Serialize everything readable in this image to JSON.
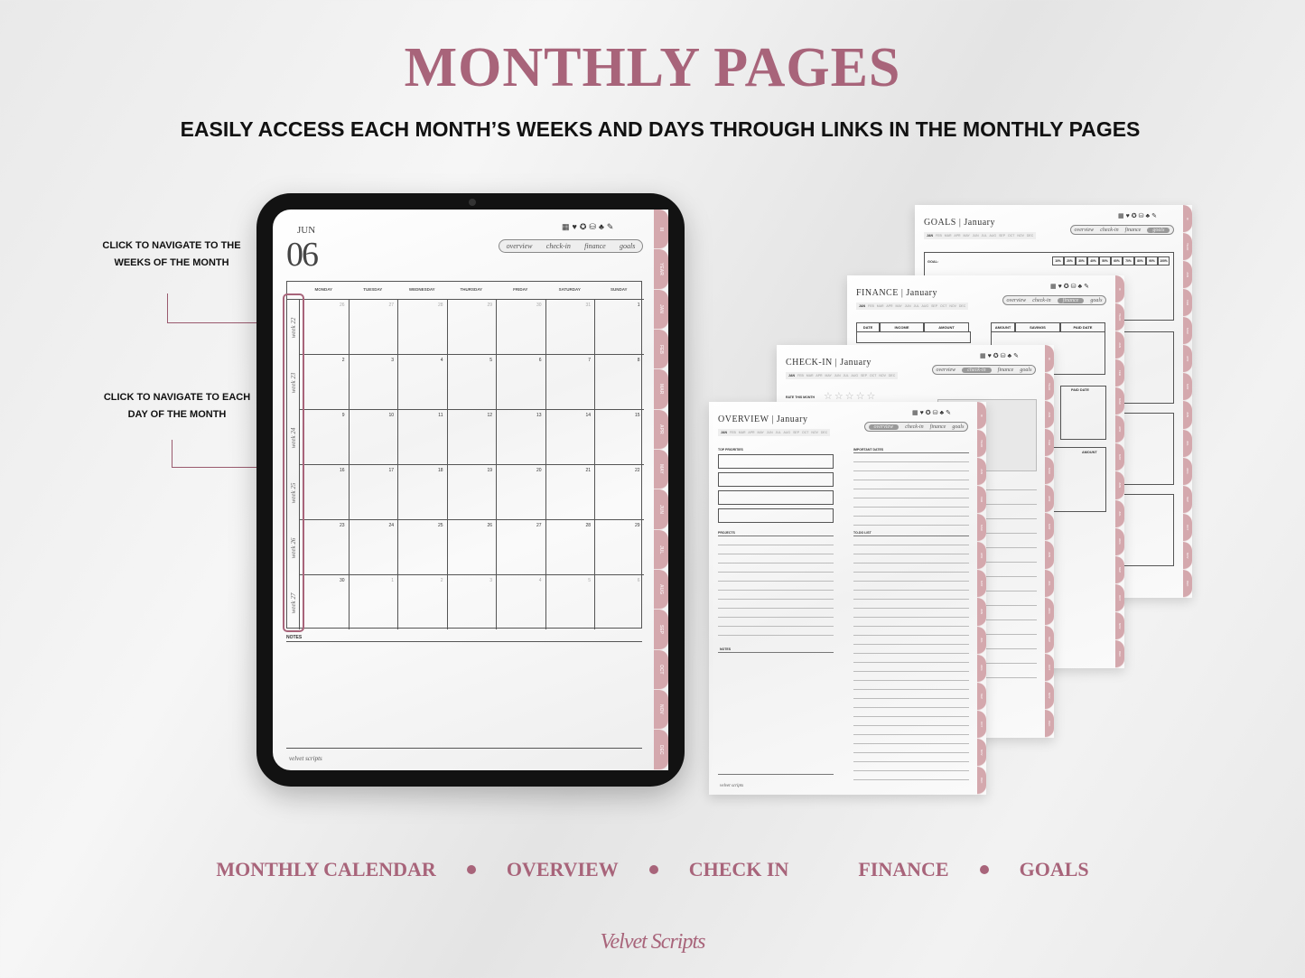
{
  "header": {
    "title": "MONTHLY PAGES",
    "subtitle": "EASILY ACCESS EACH MONTH’S WEEKS AND DAYS THROUGH LINKS IN THE MONTHLY PAGES"
  },
  "callouts": [
    {
      "line1": "CLICK TO NAVIGATE TO THE",
      "line2": "WEEKS OF THE MONTH"
    },
    {
      "line1": "CLICK TO NAVIGATE TO EACH",
      "line2": "DAY OF THE MONTH"
    }
  ],
  "colors": {
    "accent": "#a8647a",
    "tab": "#d4a8ad",
    "tablet": "#121212"
  },
  "header_icons": [
    "calendar-icon",
    "heart-icon",
    "check-badge-icon",
    "coins-icon",
    "plant-icon",
    "notes-icon"
  ],
  "nav_pill": [
    "overview",
    "check-in",
    "finance",
    "goals"
  ],
  "side_tabs": [
    "III",
    "YEAR",
    "JAN",
    "FEB",
    "MAR",
    "APR",
    "MAY",
    "JUN",
    "JUL",
    "AUG",
    "SEP",
    "OCT",
    "NOV",
    "DEC"
  ],
  "month_strip": [
    "JAN",
    "FEB",
    "MAR",
    "APR",
    "MAY",
    "JUN",
    "JUL",
    "AUG",
    "SEP",
    "OCT",
    "NOV",
    "DEC"
  ],
  "calendar": {
    "month": "JUN",
    "month_number": "06",
    "weekdays": [
      "MONDAY",
      "TUESDAY",
      "WEDNESDAY",
      "THURSDAY",
      "FRIDAY",
      "SATURDAY",
      "SUNDAY"
    ],
    "weeks": [
      {
        "label": "week 22",
        "days": [
          [
            "26",
            false
          ],
          [
            "27",
            false
          ],
          [
            "28",
            false
          ],
          [
            "29",
            false
          ],
          [
            "30",
            false
          ],
          [
            "31",
            false
          ],
          [
            "1",
            true
          ]
        ]
      },
      {
        "label": "week 23",
        "days": [
          [
            "2",
            true
          ],
          [
            "3",
            true
          ],
          [
            "4",
            true
          ],
          [
            "5",
            true
          ],
          [
            "6",
            true
          ],
          [
            "7",
            true
          ],
          [
            "8",
            true
          ]
        ]
      },
      {
        "label": "week 24",
        "days": [
          [
            "9",
            true
          ],
          [
            "10",
            true
          ],
          [
            "11",
            true
          ],
          [
            "12",
            true
          ],
          [
            "13",
            true
          ],
          [
            "14",
            true
          ],
          [
            "15",
            true
          ]
        ]
      },
      {
        "label": "week 25",
        "days": [
          [
            "16",
            true
          ],
          [
            "17",
            true
          ],
          [
            "18",
            true
          ],
          [
            "19",
            true
          ],
          [
            "20",
            true
          ],
          [
            "21",
            true
          ],
          [
            "22",
            true
          ]
        ]
      },
      {
        "label": "week 26",
        "days": [
          [
            "23",
            true
          ],
          [
            "24",
            true
          ],
          [
            "25",
            true
          ],
          [
            "26",
            true
          ],
          [
            "27",
            true
          ],
          [
            "28",
            true
          ],
          [
            "29",
            true
          ]
        ]
      },
      {
        "label": "week 27",
        "days": [
          [
            "30",
            true
          ],
          [
            "1",
            false
          ],
          [
            "2",
            false
          ],
          [
            "3",
            false
          ],
          [
            "4",
            false
          ],
          [
            "5",
            false
          ],
          [
            "6",
            false
          ]
        ]
      }
    ],
    "notes_label": "NOTES",
    "footer_brand": "velvet scripts"
  },
  "pages": {
    "goals": {
      "title": "GOALS",
      "month": "January",
      "goal_label": "GOAL:",
      "percents": [
        "10%",
        "20%",
        "30%",
        "40%",
        "50%",
        "60%",
        "70%",
        "80%",
        "90%",
        "100%"
      ],
      "active": 3
    },
    "finance": {
      "title": "FINANCE",
      "month": "January",
      "table1": [
        "DATE",
        "INCOME",
        "AMOUNT"
      ],
      "table2": [
        "AMOUNT",
        "SAVINGS",
        "PAID DATE"
      ],
      "paid_date": "PAID DATE",
      "amount": "AMOUNT",
      "active": 2
    },
    "checkin": {
      "title": "CHECK-IN",
      "month": "January",
      "rate_label": "RATE THIS MONTH",
      "stars": 5,
      "active": 1
    },
    "overview": {
      "title": "OVERVIEW",
      "month": "January",
      "top_priorities": "TOP PRIORITIES",
      "important_dates": "IMPORTANT DATES",
      "projects": "PROJECTS",
      "todo": "TO-DO LIST",
      "notes": "NOTES",
      "footer_brand": "velvet scripts",
      "active": 0
    }
  },
  "legend": [
    "MONTHLY CALENDAR",
    "OVERVIEW",
    "CHECK IN",
    "FINANCE",
    "GOALS"
  ],
  "brand": "Velvet Scripts"
}
